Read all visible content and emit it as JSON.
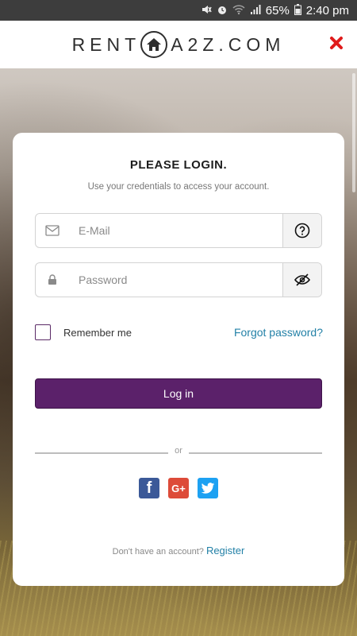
{
  "status_bar": {
    "battery": "65%",
    "time": "2:40 pm"
  },
  "header": {
    "brand_left": "RENT",
    "brand_right": "A2Z.COM"
  },
  "card": {
    "title": "PLEASE LOGIN.",
    "subtitle": "Use your credentials to access your account.",
    "email_placeholder": "E-Mail",
    "password_placeholder": "Password",
    "remember_label": "Remember me",
    "forgot_link": "Forgot password?",
    "login_button": "Log in",
    "divider_text": "or",
    "footer_text": "Don't have an account?",
    "register_link": "Register"
  },
  "social": {
    "facebook_color": "#3b5998",
    "google_color": "#dd4b39",
    "twitter_color": "#1da1f2",
    "google_label": "G+",
    "facebook_label": "f"
  },
  "colors": {
    "accent": "#5b216a",
    "link": "#2381a7",
    "close": "#e01b1b"
  }
}
